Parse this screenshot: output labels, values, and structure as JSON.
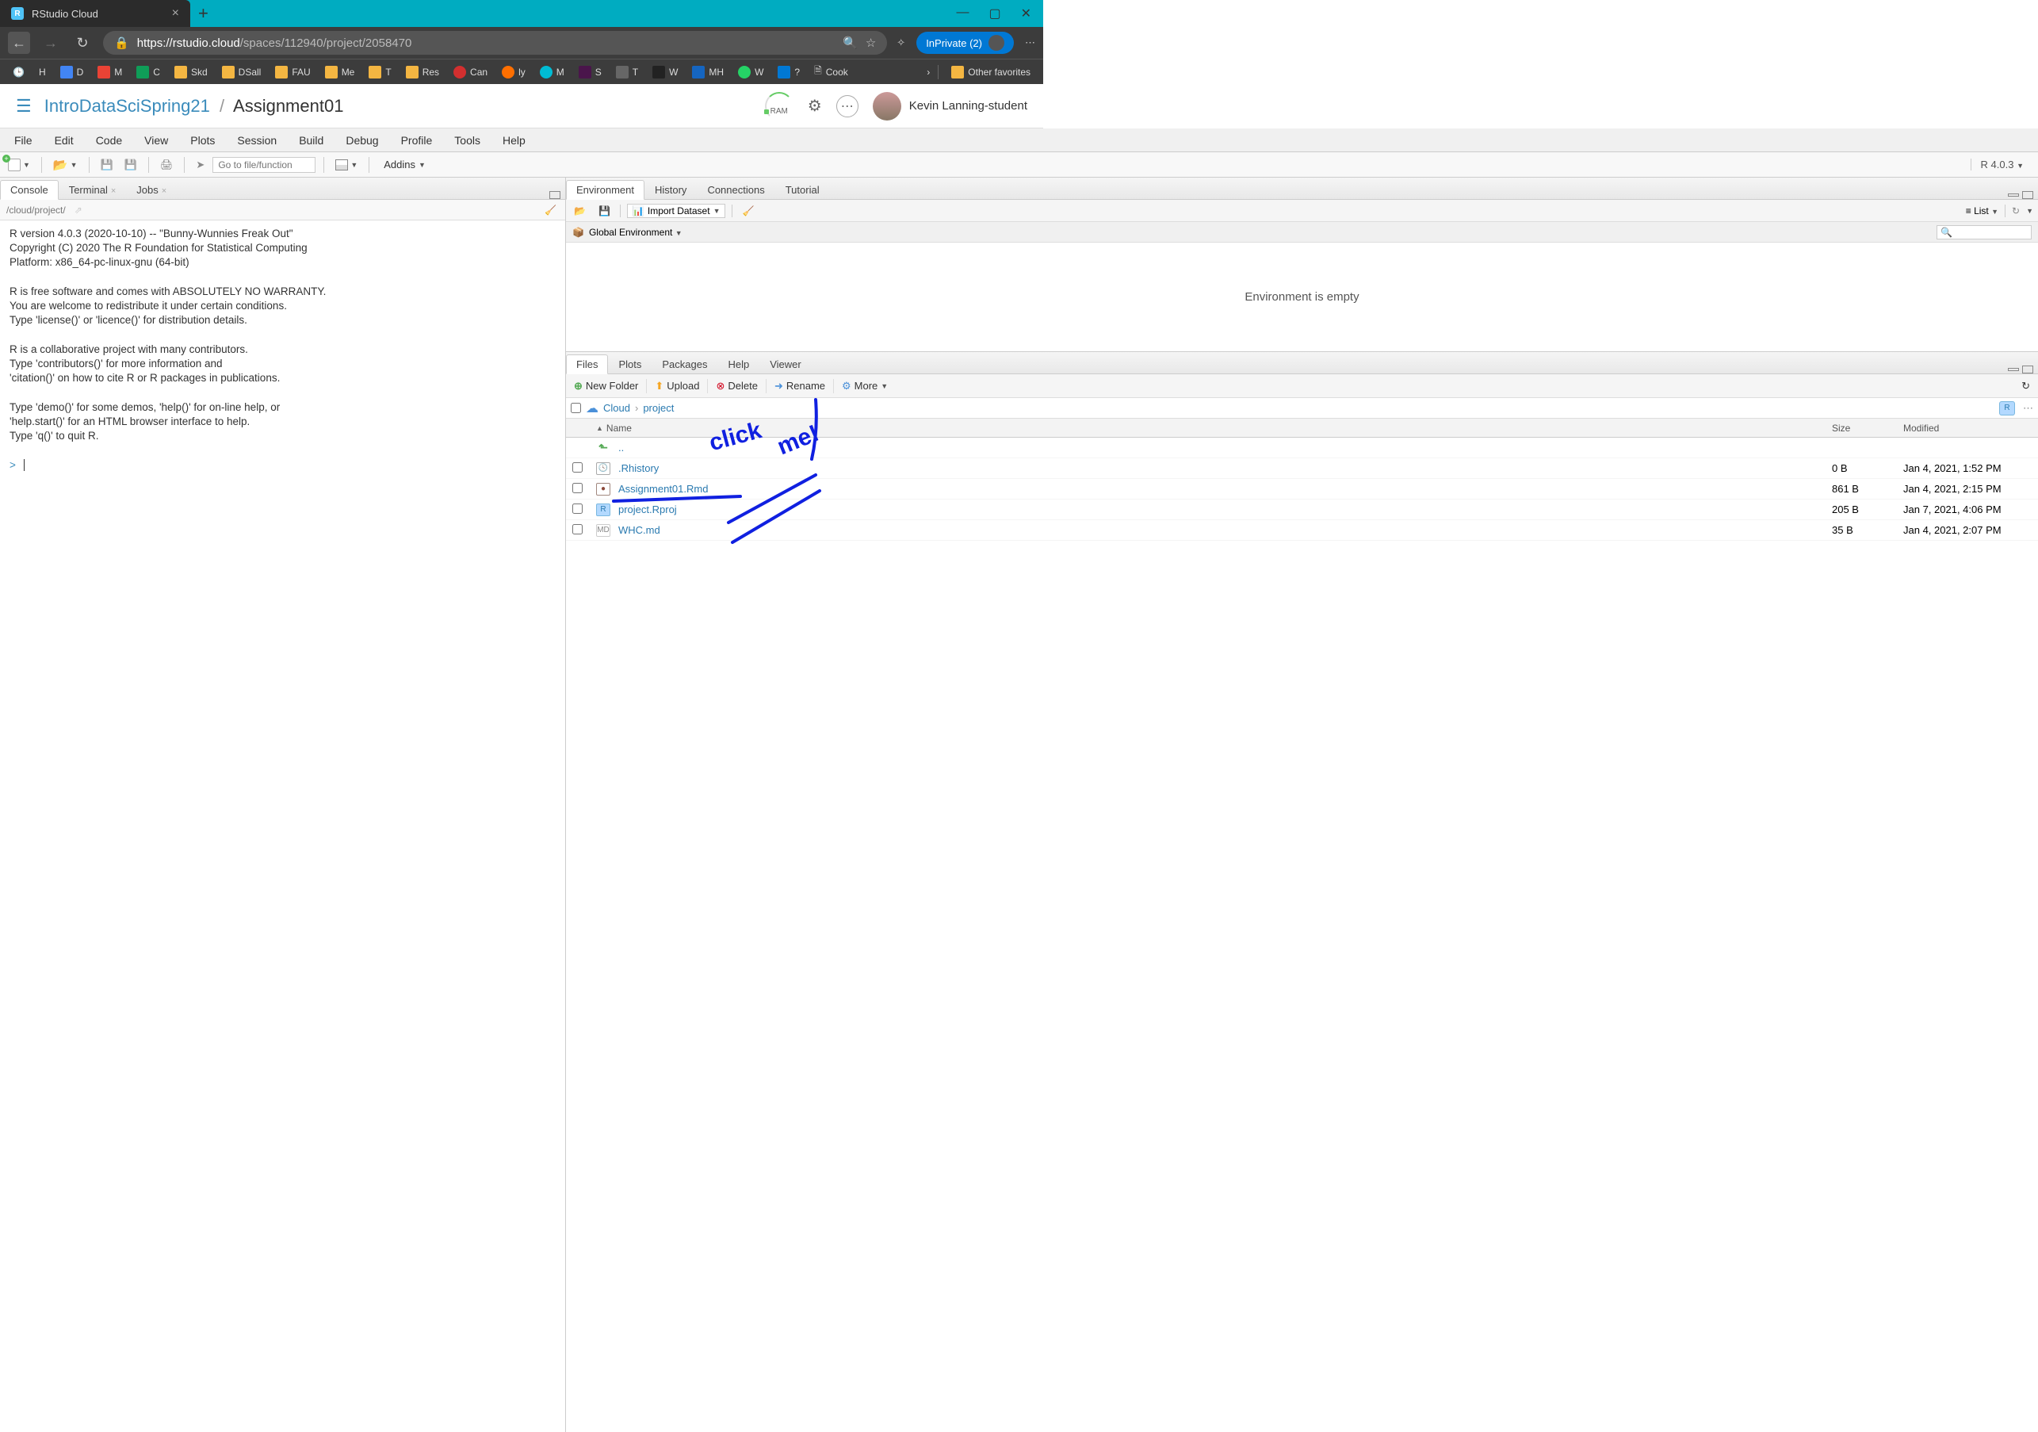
{
  "browser": {
    "tab_title": "RStudio Cloud",
    "new_tab": "+",
    "url_host": "https://rstudio.cloud",
    "url_path": "/spaces/112940/project/2058470",
    "inprivate_label": "InPrivate (2)",
    "bookmarks": [
      "H",
      "D",
      "M",
      "C",
      "Skd",
      "DSall",
      "FAU",
      "Me",
      "T",
      "Res",
      "Can",
      "ly",
      "M",
      "S",
      "T",
      "W",
      "MH",
      "W",
      "?",
      "Cook"
    ],
    "other_favorites": "Other favorites"
  },
  "rsc": {
    "workspace": "IntroDataSciSpring21",
    "project": "Assignment01",
    "ram_label": "RAM",
    "user_name": "Kevin Lanning-student"
  },
  "ide": {
    "menu": [
      "File",
      "Edit",
      "Code",
      "View",
      "Plots",
      "Session",
      "Build",
      "Debug",
      "Profile",
      "Tools",
      "Help"
    ],
    "goto_placeholder": "Go to file/function",
    "addins_label": "Addins",
    "r_version": "R 4.0.3",
    "console": {
      "tabs": {
        "console": "Console",
        "terminal": "Terminal",
        "jobs": "Jobs"
      },
      "path": "/cloud/project/",
      "text": "R version 4.0.3 (2020-10-10) -- \"Bunny-Wunnies Freak Out\"\nCopyright (C) 2020 The R Foundation for Statistical Computing\nPlatform: x86_64-pc-linux-gnu (64-bit)\n\nR is free software and comes with ABSOLUTELY NO WARRANTY.\nYou are welcome to redistribute it under certain conditions.\nType 'license()' or 'licence()' for distribution details.\n\nR is a collaborative project with many contributors.\nType 'contributors()' for more information and\n'citation()' on how to cite R or R packages in publications.\n\nType 'demo()' for some demos, 'help()' for on-line help, or\n'help.start()' for an HTML browser interface to help.\nType 'q()' to quit R.\n",
      "prompt": ">"
    },
    "env": {
      "tabs": {
        "environment": "Environment",
        "history": "History",
        "connections": "Connections",
        "tutorial": "Tutorial"
      },
      "import_label": "Import Dataset",
      "list_label": "List",
      "global_env": "Global Environment",
      "empty_msg": "Environment is empty"
    },
    "files": {
      "tabs": {
        "files": "Files",
        "plots": "Plots",
        "packages": "Packages",
        "help": "Help",
        "viewer": "Viewer"
      },
      "toolbar": {
        "new_folder": "New Folder",
        "upload": "Upload",
        "delete": "Delete",
        "rename": "Rename",
        "more": "More"
      },
      "breadcrumb": {
        "root": "Cloud",
        "folder": "project"
      },
      "headers": {
        "name": "Name",
        "size": "Size",
        "modified": "Modified"
      },
      "up_dir": "..",
      "rows": [
        {
          "name": ".Rhistory",
          "size": "0 B",
          "modified": "Jan 4, 2021, 1:52 PM",
          "icon": "hist"
        },
        {
          "name": "Assignment01.Rmd",
          "size": "861 B",
          "modified": "Jan 4, 2021, 2:15 PM",
          "icon": "rmd"
        },
        {
          "name": "project.Rproj",
          "size": "205 B",
          "modified": "Jan 7, 2021, 4:06 PM",
          "icon": "rproj"
        },
        {
          "name": "WHC.md",
          "size": "35 B",
          "modified": "Jan 4, 2021, 2:07 PM",
          "icon": "md"
        }
      ]
    }
  },
  "annotation": {
    "text": "click me!"
  }
}
